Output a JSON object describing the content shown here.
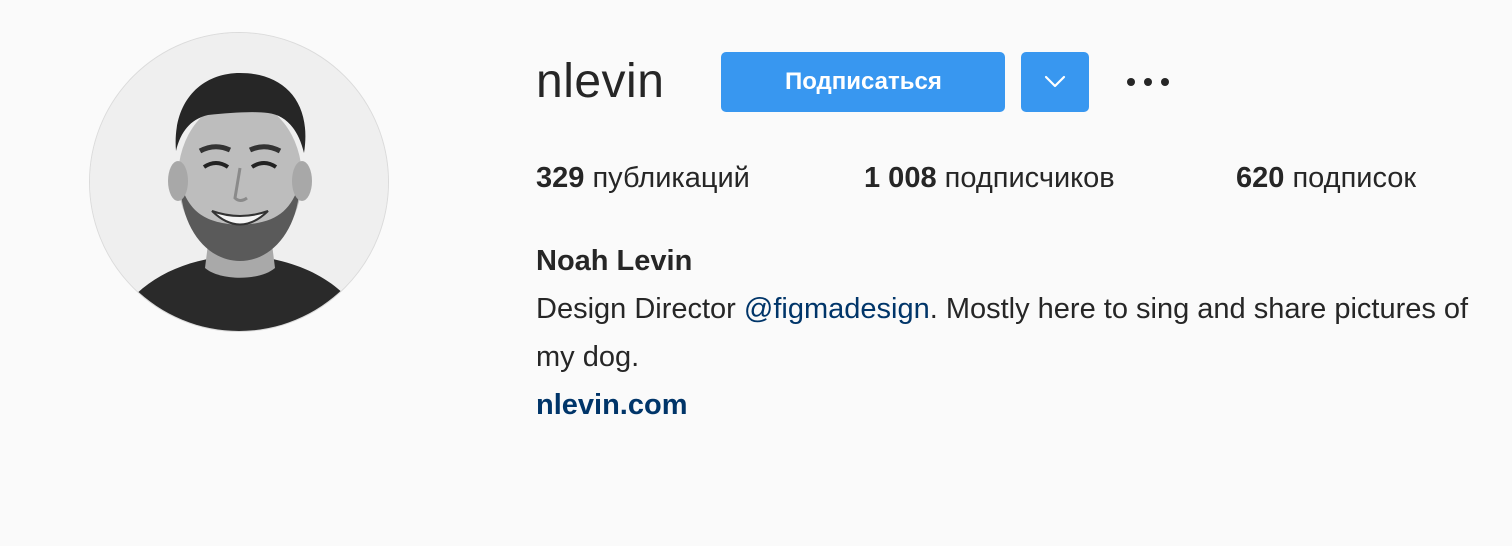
{
  "profile": {
    "username": "nlevin",
    "follow_label": "Подписаться",
    "full_name": "Noah Levin",
    "bio_before": "Design Director ",
    "bio_mention": "@figmadesign",
    "bio_after": ". Mostly here to sing and share pictures of my dog.",
    "website": "nlevin.com"
  },
  "stats": {
    "posts_count": "329",
    "posts_label": " публикаций",
    "followers_count": "1 008",
    "followers_label": " подписчиков",
    "following_count": "620",
    "following_label": " подписок"
  },
  "icons": {
    "avatar": "profile-photo",
    "dropdown": "chevron-down-icon",
    "more": "more-horizontal-icon"
  },
  "colors": {
    "background": "#fafafa",
    "button": "#3897f0",
    "link": "#003569",
    "text": "#262626"
  }
}
